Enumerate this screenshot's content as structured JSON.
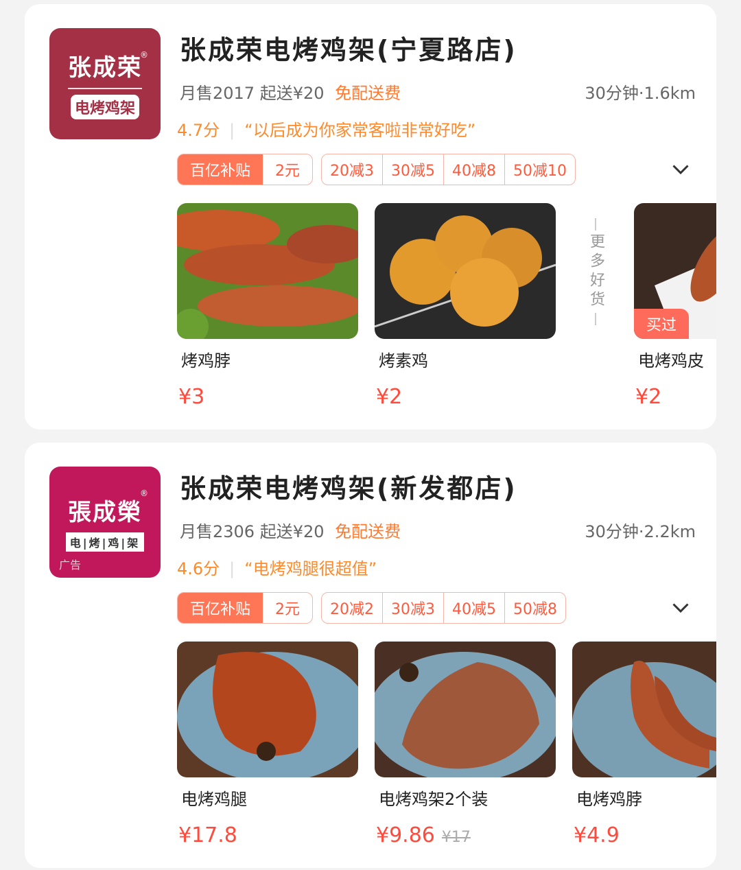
{
  "stores": [
    {
      "logo": {
        "brand": "张成荣",
        "sub": "电烤鸡架",
        "reg": "®"
      },
      "title": "张成荣电烤鸡架(宁夏路店)",
      "monthly_sales": "月售2017",
      "min_order": "起送¥20",
      "free_delivery": "免配送费",
      "distance": "30分钟·1.6km",
      "score": "4.7分",
      "review": "“以后成为你家常客啦非常好吃”",
      "subsidy": {
        "label": "百亿补贴",
        "amount": "2元"
      },
      "discounts": [
        "20减3",
        "30减5",
        "40减8",
        "50减10"
      ],
      "products": [
        {
          "name": "烤鸡脖",
          "price": "¥3"
        },
        {
          "name": "烤素鸡",
          "price": "¥2"
        },
        {
          "name": "电烤鸡皮",
          "price": "¥2",
          "badge": "买过"
        }
      ],
      "more_label": "更多好货"
    },
    {
      "logo": {
        "brand": "張成榮",
        "sub": "电|烤|鸡|架",
        "reg": "®",
        "ad": "广告"
      },
      "title": "张成荣电烤鸡架(新发都店)",
      "monthly_sales": "月售2306",
      "min_order": "起送¥20",
      "free_delivery": "免配送费",
      "distance": "30分钟·2.2km",
      "score": "4.6分",
      "review": "“电烤鸡腿很超值”",
      "subsidy": {
        "label": "百亿补贴",
        "amount": "2元"
      },
      "discounts": [
        "20减2",
        "30减3",
        "40减5",
        "50减8"
      ],
      "products": [
        {
          "name": "电烤鸡腿",
          "price": "¥17.8"
        },
        {
          "name": "电烤鸡架2个装",
          "price": "¥9.86",
          "old_price": "¥17"
        },
        {
          "name": "电烤鸡脖",
          "price": "¥4.9"
        }
      ]
    }
  ],
  "icons": {
    "expand": "chevron-down-icon"
  },
  "colors": {
    "accent": "#ff7656",
    "price": "#ff4a3c",
    "rating": "#ff8a2a"
  }
}
